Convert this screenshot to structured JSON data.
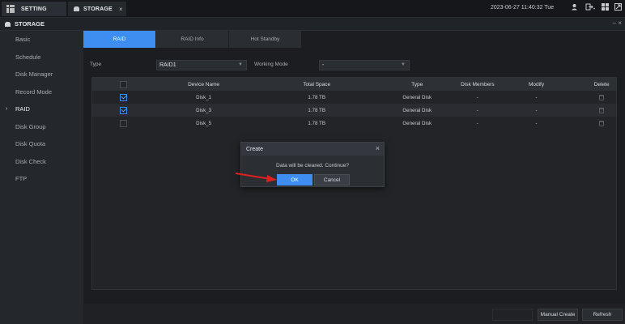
{
  "topbar": {
    "tabs": [
      {
        "label": "SETTING",
        "icon": "grid-icon"
      },
      {
        "label": "STORAGE",
        "icon": "storage-icon",
        "close": "×"
      }
    ],
    "datetime": "2023-06-27 11:40:32 Tue",
    "icons": [
      "user-icon",
      "logout-icon",
      "grid-icon",
      "fullscreen-icon"
    ]
  },
  "titlebar": {
    "title": "STORAGE",
    "controls": "– ×"
  },
  "sidebar": {
    "items": [
      {
        "label": "Basic"
      },
      {
        "label": "Schedule"
      },
      {
        "label": "Disk Manager"
      },
      {
        "label": "Record Mode"
      },
      {
        "label": "RAID",
        "active": true,
        "marker": "›"
      },
      {
        "label": "Disk Group"
      },
      {
        "label": "Disk Quota"
      },
      {
        "label": "Disk Check"
      },
      {
        "label": "FTP"
      }
    ]
  },
  "subtabs": [
    {
      "label": "RAID",
      "active": true
    },
    {
      "label": "RAID Info"
    },
    {
      "label": "Hot Standby"
    }
  ],
  "form": {
    "type_label": "Type",
    "type_value": "RAID1",
    "mode_label": "Working Mode",
    "mode_value": "-"
  },
  "table": {
    "columns": [
      "",
      "Device Name",
      "Total Space",
      "Type",
      "Disk Members",
      "Modify",
      "Delete"
    ],
    "rows": [
      {
        "checked": true,
        "name": "Disk_1",
        "space": "1.78 TB",
        "type": "General Disk",
        "members": "-",
        "modify": "-"
      },
      {
        "checked": true,
        "name": "Disk_3",
        "space": "1.78 TB",
        "type": "General Disk",
        "members": "-",
        "modify": "-"
      },
      {
        "checked": false,
        "name": "Disk_5",
        "space": "1.78 TB",
        "type": "General Disk",
        "members": "-",
        "modify": "-"
      }
    ]
  },
  "footer": {
    "manual_create": "Manual Create",
    "refresh": "Refresh"
  },
  "dialog": {
    "title": "Create",
    "close": "×",
    "message": "Data will be cleared. Continue?",
    "ok": "OK",
    "cancel": "Cancel"
  },
  "colors": {
    "accent": "#3d8ef0",
    "arrow": "#e0201f"
  }
}
